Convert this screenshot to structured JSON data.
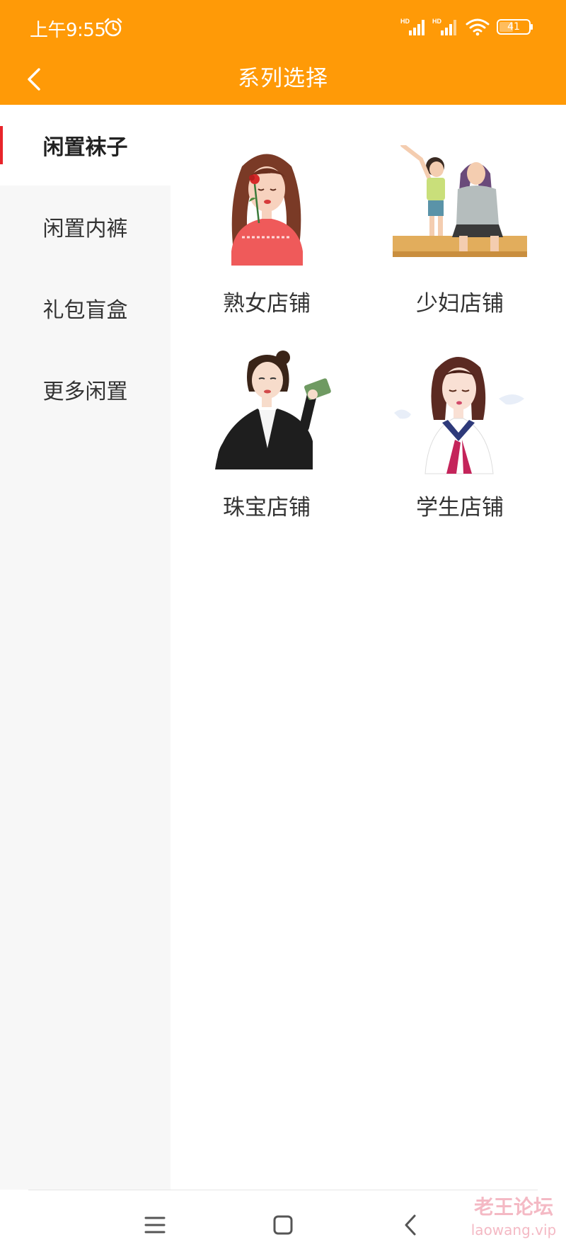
{
  "status_bar": {
    "time": "上午9:55",
    "signal_1_label": "HD",
    "signal_2_label": "HD",
    "battery": "41",
    "icons": [
      "alarm-icon",
      "signal-icon",
      "signal-icon",
      "wifi-icon",
      "battery-icon"
    ]
  },
  "header": {
    "title": "系列选择",
    "back_icon": "chevron-left-icon",
    "background": "#ff9a07"
  },
  "sidebar": {
    "items": [
      {
        "label": "闲置袜子",
        "active": true
      },
      {
        "label": "闲置内裤",
        "active": false
      },
      {
        "label": "礼包盲盒",
        "active": false
      },
      {
        "label": "更多闲置",
        "active": false
      }
    ],
    "active_indicator_color": "#e8242a"
  },
  "shops": [
    {
      "label": "熟女店铺",
      "image": "woman-with-rose-illustration"
    },
    {
      "label": "少妇店铺",
      "image": "mother-and-child-illustration"
    },
    {
      "label": "珠宝店铺",
      "image": "businesswoman-illustration"
    },
    {
      "label": "学生店铺",
      "image": "schoolgirl-illustration"
    }
  ],
  "nav_bar": {
    "icons": [
      "menu-icon",
      "home-icon",
      "back-icon"
    ]
  },
  "watermark": {
    "text": "老王论坛",
    "url": "laowang.vip"
  }
}
